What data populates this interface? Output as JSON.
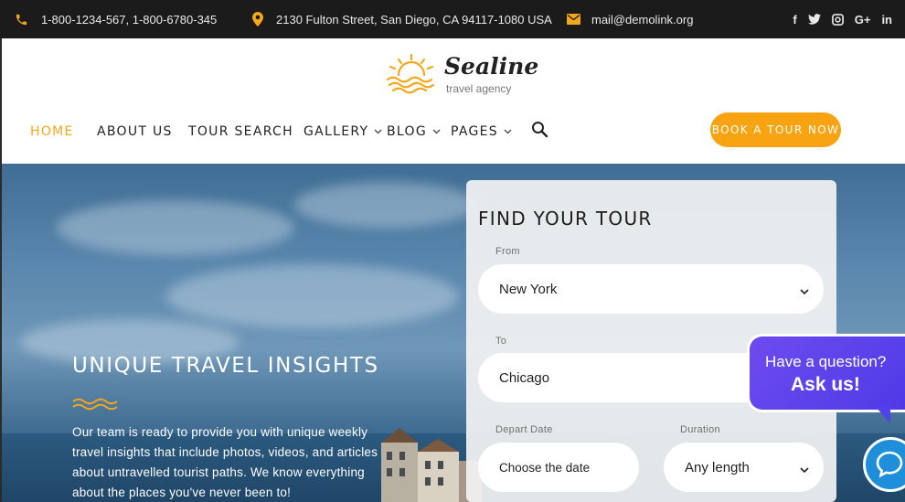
{
  "topbar": {
    "phone": "1-800-1234-567,  1-800-6780-345",
    "address": "2130 Fulton Street, San Diego, CA 94117-1080 USA",
    "email": "mail@demolink.org",
    "social_icons": [
      "facebook-icon",
      "twitter-icon",
      "instagram-icon",
      "google-plus-icon",
      "linkedin-icon"
    ],
    "social_glyphs": [
      "f",
      "t",
      "◘",
      "G+",
      "in"
    ]
  },
  "logo": {
    "name": "Sealine",
    "tagline": "travel agency"
  },
  "nav": {
    "items": [
      {
        "label": "HOME",
        "active": true,
        "dropdown": false
      },
      {
        "label": "ABOUT US",
        "active": false,
        "dropdown": false
      },
      {
        "label": "TOUR SEARCH",
        "active": false,
        "dropdown": false
      },
      {
        "label": "GALLERY",
        "active": false,
        "dropdown": true
      },
      {
        "label": "BLOG",
        "active": false,
        "dropdown": true
      },
      {
        "label": "PAGES",
        "active": false,
        "dropdown": true
      }
    ],
    "cta_label": "BOOK A TOUR NOW"
  },
  "hero": {
    "title": "UNIQUE TRAVEL INSIGHTS",
    "text": "Our team is ready to provide you with unique weekly travel insights that include photos, videos, and articles about untravelled tourist paths. We know everything about the places you've never been to!"
  },
  "search_panel": {
    "title": "FIND YOUR TOUR",
    "from_label": "From",
    "from_value": "New York",
    "to_label": "To",
    "to_value": "Chicago",
    "depart_label": "Depart Date",
    "depart_placeholder": "Choose the date",
    "duration_label": "Duration",
    "duration_value": "Any length"
  },
  "chat": {
    "question": "Have a question?",
    "cta": "Ask us!"
  },
  "colors": {
    "accent": "#f8a412",
    "topbar_bg": "#1b1b1b",
    "chat_purple": "#5a3fea",
    "chat_blue": "#1e8fd8"
  }
}
